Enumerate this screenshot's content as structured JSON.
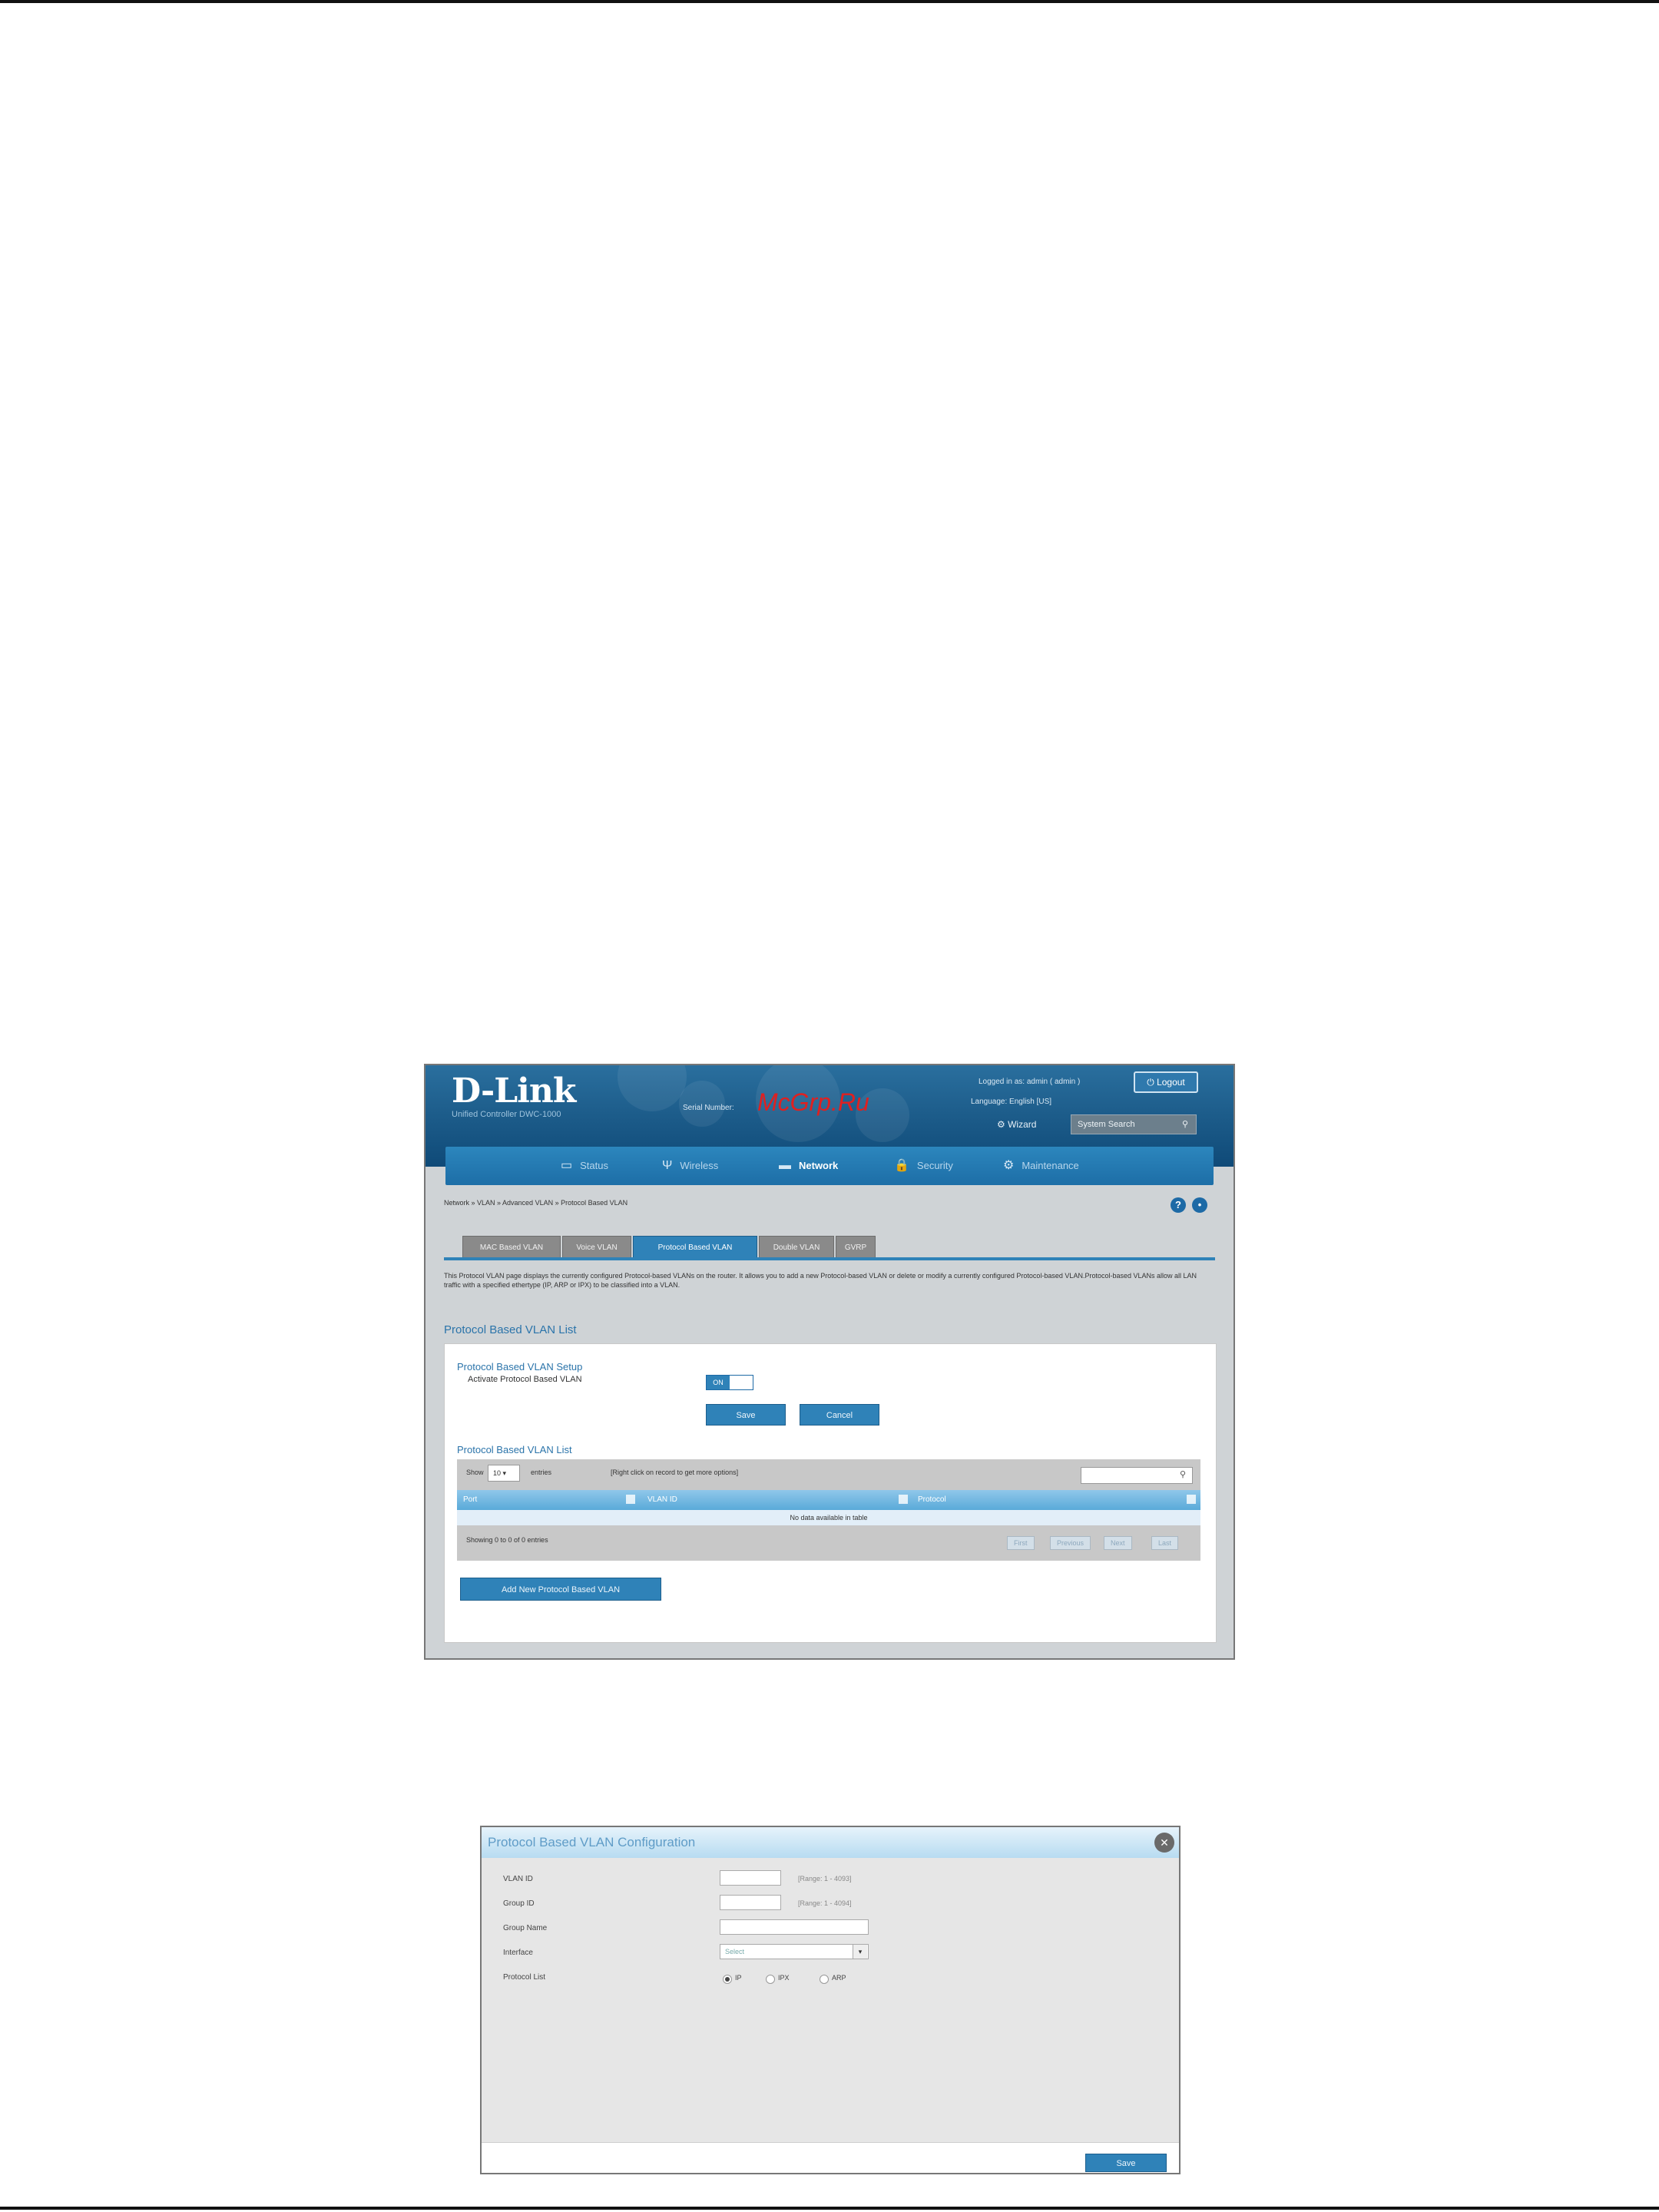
{
  "shot1": {
    "logo": "D-Link",
    "logo_sub": "Unified Controller  DWC-1000",
    "serial_label": "Serial Number:",
    "watermark": "McGrp.Ru",
    "logged_in": "Logged in as:  admin ( admin )",
    "logout": "Logout",
    "language": "Language:  English [US]",
    "wizard": "Wizard",
    "search_placeholder": "System Search",
    "nav": [
      "Status",
      "Wireless",
      "Network",
      "Security",
      "Maintenance"
    ],
    "nav_active": "Network",
    "breadcrumb": "Network  »  VLAN  »  Advanced VLAN  »  Protocol Based VLAN",
    "tabs": [
      "MAC Based VLAN",
      "Voice VLAN",
      "Protocol Based VLAN",
      "Double VLAN",
      "GVRP"
    ],
    "tab_active": "Protocol Based VLAN",
    "description": "This Protocol VLAN page displays the currently configured Protocol-based VLANs on the router. It allows you to add a new Protocol-based VLAN or delete or modify a currently configured Protocol-based VLAN.Protocol-based VLANs allow all LAN traffic with a specified ethertype (IP, ARP or IPX) to be classified into a VLAN.",
    "section_title": "Protocol Based VLAN List",
    "setup_title": "Protocol Based VLAN Setup",
    "activate_label": "Activate Protocol Based VLAN",
    "toggle_on": "ON",
    "toggle_off": "",
    "save": "Save",
    "cancel": "Cancel",
    "list_title": "Protocol Based VLAN List",
    "show": "Show",
    "show_value": "10",
    "entries": "entries",
    "hint": "[Right click on record to get more options]",
    "columns": [
      "Port",
      "VLAN ID",
      "Protocol"
    ],
    "empty": "No data available in table",
    "showing": "Showing 0 to 0 of 0 entries",
    "pager": [
      "First",
      "Previous",
      "Next",
      "Last"
    ],
    "add_new": "Add New Protocol Based VLAN"
  },
  "shot2": {
    "title": "Protocol Based VLAN Configuration",
    "fields": {
      "vlan_id": {
        "label": "VLAN ID",
        "range": "[Range: 1 - 4093]"
      },
      "group_id": {
        "label": "Group ID",
        "range": "[Range: 1 - 4094]"
      },
      "group_name": {
        "label": "Group Name"
      },
      "interface": {
        "label": "Interface",
        "value": "Select"
      },
      "protocol": {
        "label": "Protocol List",
        "options": [
          "IP",
          "IPX",
          "ARP"
        ],
        "selected": "IP"
      }
    },
    "save": "Save"
  },
  "colors": {
    "brand_blue": "#1b5a88",
    "accent_blue": "#2f82b8",
    "link_blue": "#2b74aa",
    "watermark_red": "#e02020"
  }
}
